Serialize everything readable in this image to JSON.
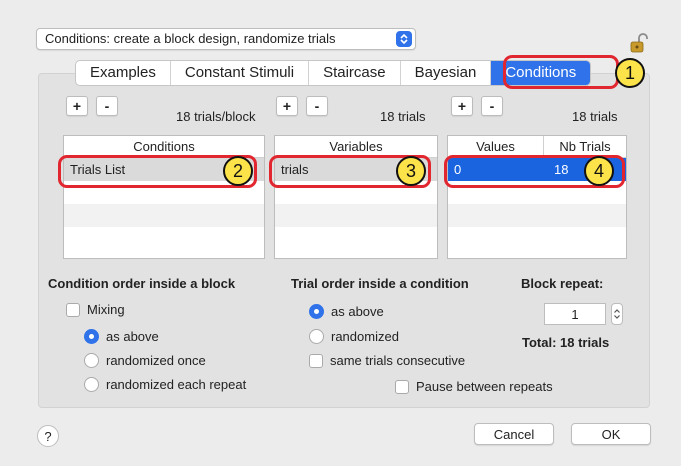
{
  "top_select": {
    "value": "Conditions: create a block design, randomize trials"
  },
  "tabs": [
    "Examples",
    "Constant Stimuli",
    "Staircase",
    "Bayesian",
    "Conditions"
  ],
  "badges": [
    "1",
    "2",
    "3",
    "4"
  ],
  "conditions": {
    "header": "Conditions",
    "count": "18 trials/block",
    "rows": [
      "Trials List"
    ]
  },
  "variables": {
    "header": "Variables",
    "count": "18 trials",
    "rows": [
      "trials"
    ]
  },
  "values": {
    "header_values": "Values",
    "header_nb": "Nb Trials",
    "count": "18 trials",
    "row_value": "0",
    "row_nb": "18"
  },
  "buttons": {
    "plus": "+",
    "minus": "-"
  },
  "condition_order": {
    "title": "Condition order inside a block",
    "mixing": "Mixing",
    "as_above": "as above",
    "randomized_once": "randomized once",
    "randomized_each": "randomized each repeat"
  },
  "trial_order": {
    "title": "Trial order inside a condition",
    "as_above": "as above",
    "randomized": "randomized",
    "same_consecutive": "same trials consecutive",
    "pause": "Pause between repeats"
  },
  "block_repeat": {
    "title": "Block repeat:",
    "value": "1",
    "total": "Total: 18 trials"
  },
  "footer": {
    "help": "?",
    "cancel": "Cancel",
    "ok": "OK"
  }
}
